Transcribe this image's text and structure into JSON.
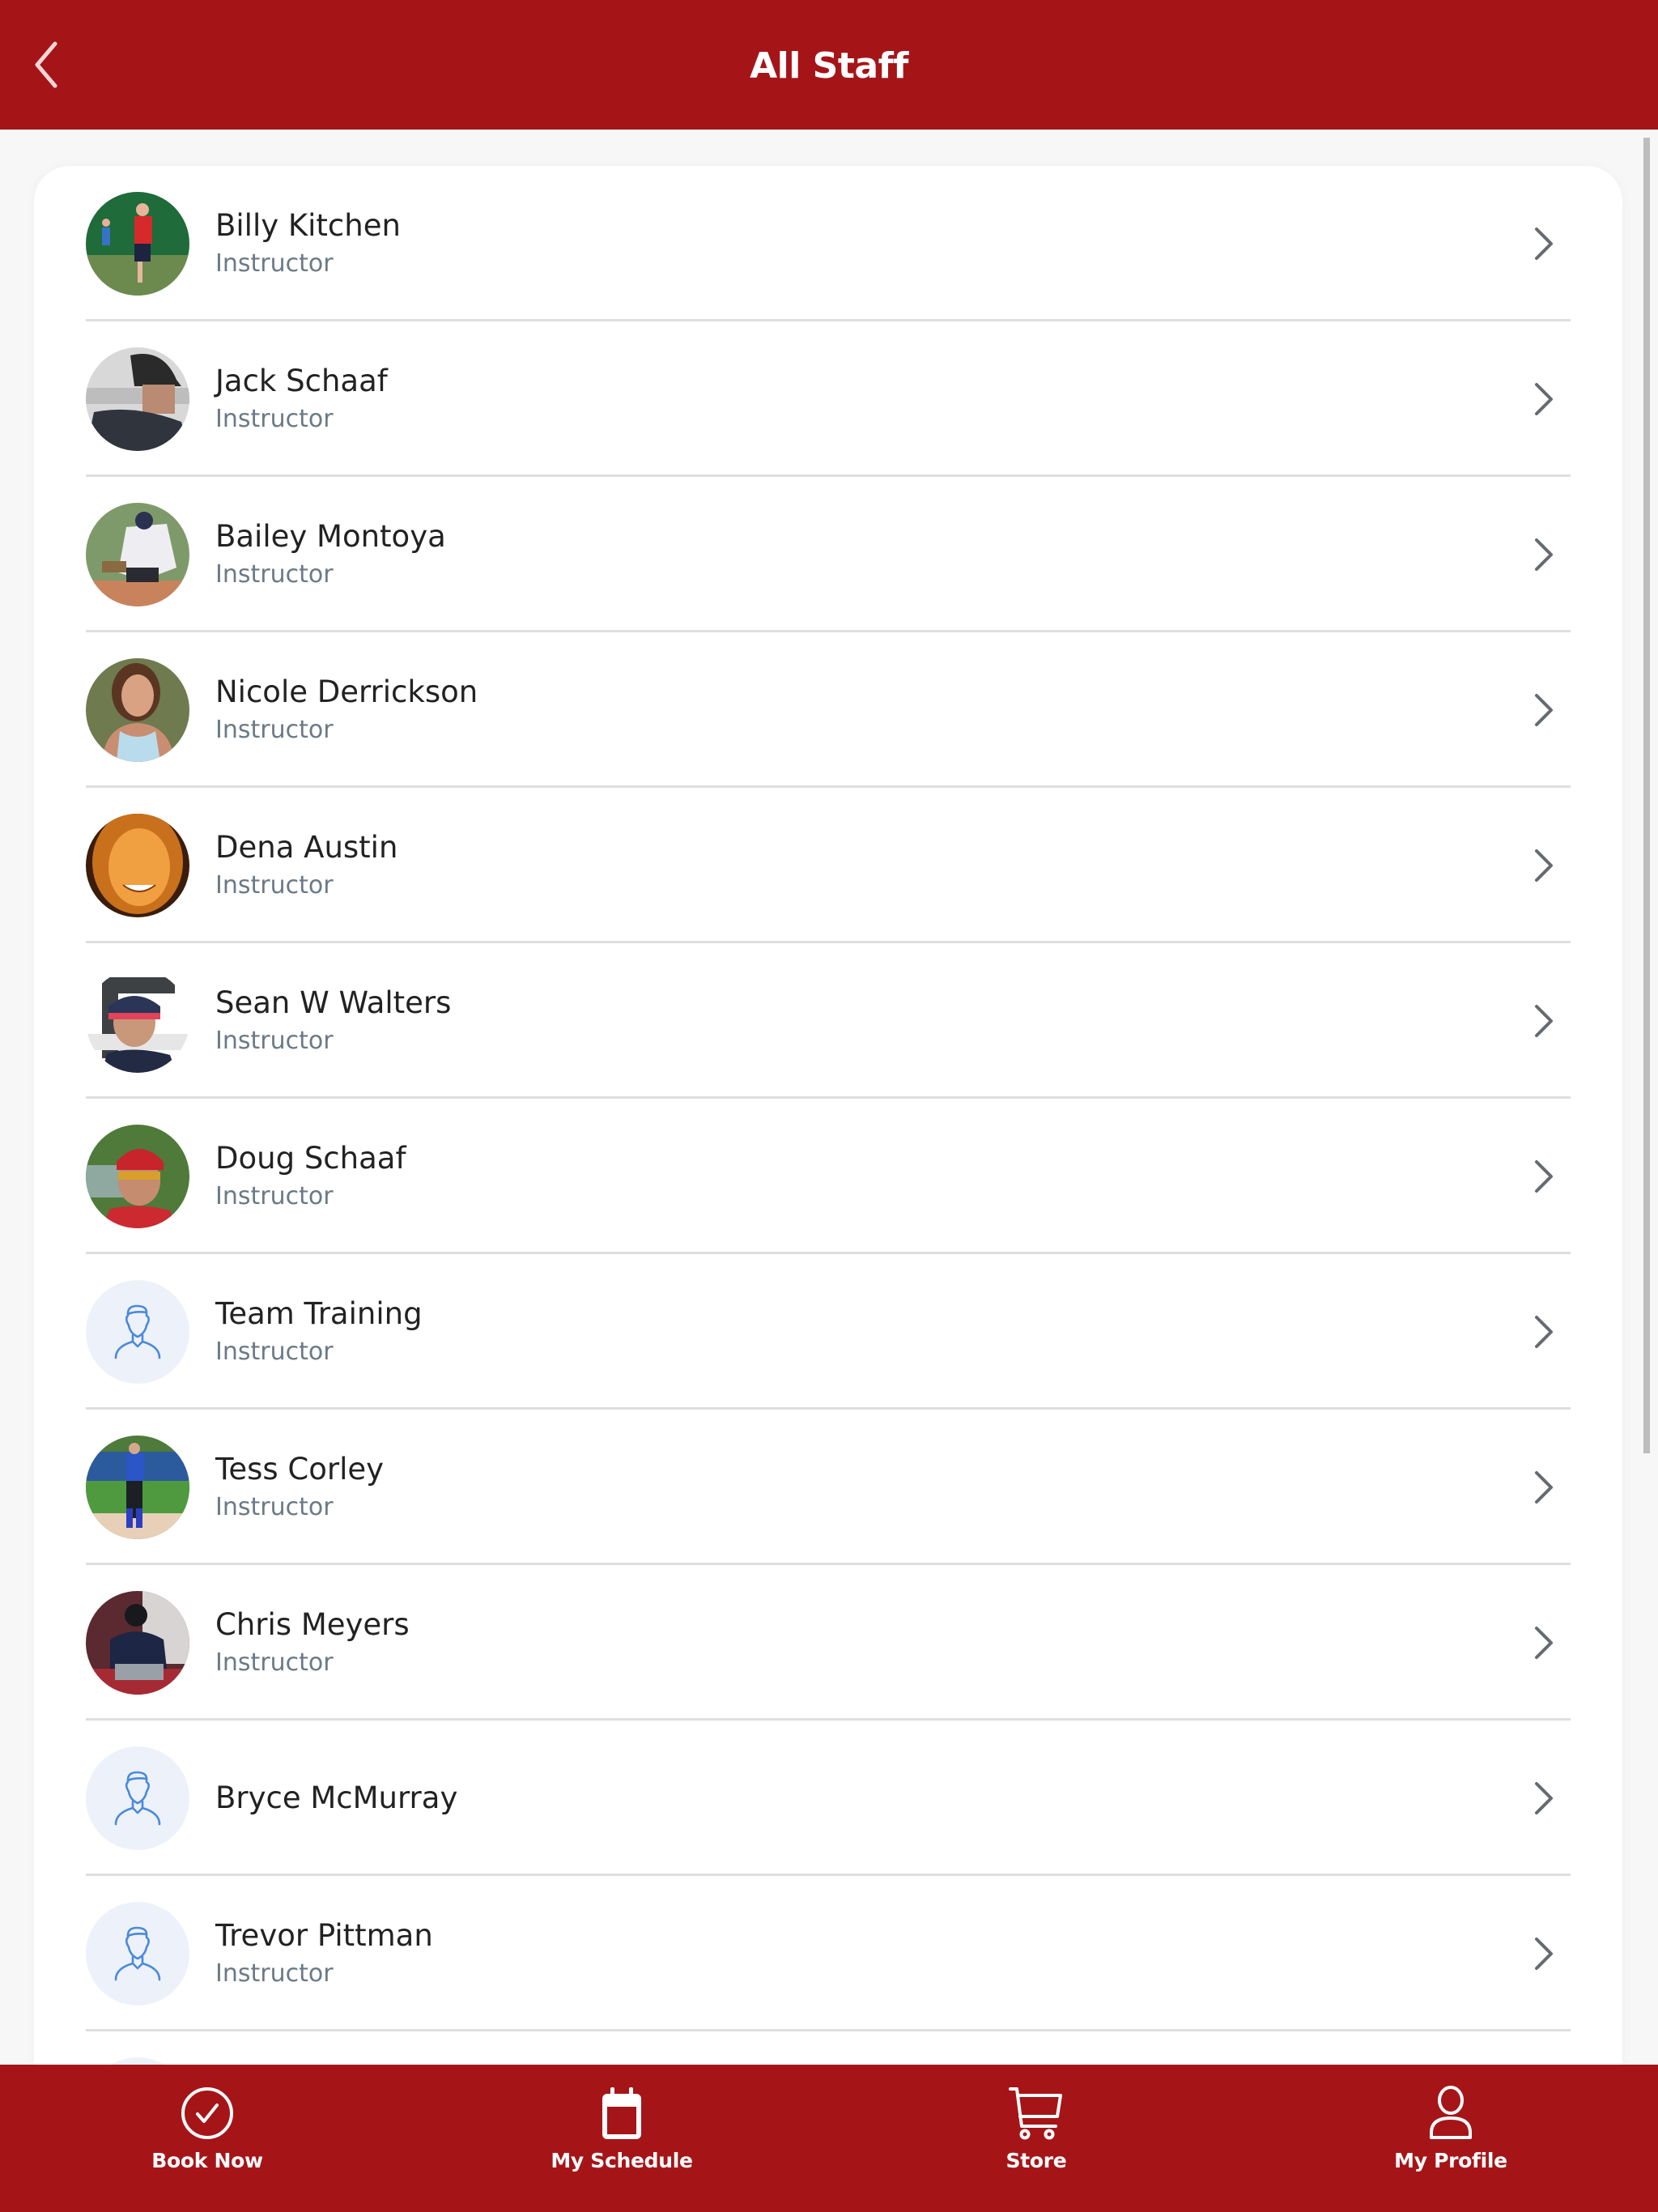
{
  "header": {
    "title": "All Staff",
    "back_icon": "chevron-left-icon"
  },
  "colors": {
    "brand": "#a51518",
    "name_text": "#222222",
    "role_text": "#6b7a86",
    "placeholder_avatar_bg": "#edf1fa",
    "placeholder_icon": "#4a8ad8",
    "divider": "#dedede"
  },
  "staff": [
    {
      "name": "Billy Kitchen",
      "role": "Instructor",
      "avatar": "photo"
    },
    {
      "name": "Jack Schaaf",
      "role": "Instructor",
      "avatar": "photo"
    },
    {
      "name": "Bailey Montoya",
      "role": "Instructor",
      "avatar": "photo"
    },
    {
      "name": "Nicole Derrickson",
      "role": "Instructor",
      "avatar": "photo"
    },
    {
      "name": "Dena Austin",
      "role": "Instructor",
      "avatar": "photo"
    },
    {
      "name": "Sean W Walters",
      "role": "Instructor",
      "avatar": "photo"
    },
    {
      "name": "Doug Schaaf",
      "role": "Instructor",
      "avatar": "photo"
    },
    {
      "name": "Team Training",
      "role": "Instructor",
      "avatar": "placeholder"
    },
    {
      "name": "Tess Corley",
      "role": "Instructor",
      "avatar": "photo"
    },
    {
      "name": "Chris Meyers",
      "role": "Instructor",
      "avatar": "photo"
    },
    {
      "name": "Bryce McMurray",
      "role": "",
      "avatar": "placeholder"
    },
    {
      "name": "Trevor Pittman",
      "role": "Instructor",
      "avatar": "placeholder"
    }
  ],
  "bottom_nav": [
    {
      "label": "Book Now",
      "icon": "check-circle-icon"
    },
    {
      "label": "My Schedule",
      "icon": "calendar-icon"
    },
    {
      "label": "Store",
      "icon": "cart-icon"
    },
    {
      "label": "My Profile",
      "icon": "user-icon"
    }
  ]
}
